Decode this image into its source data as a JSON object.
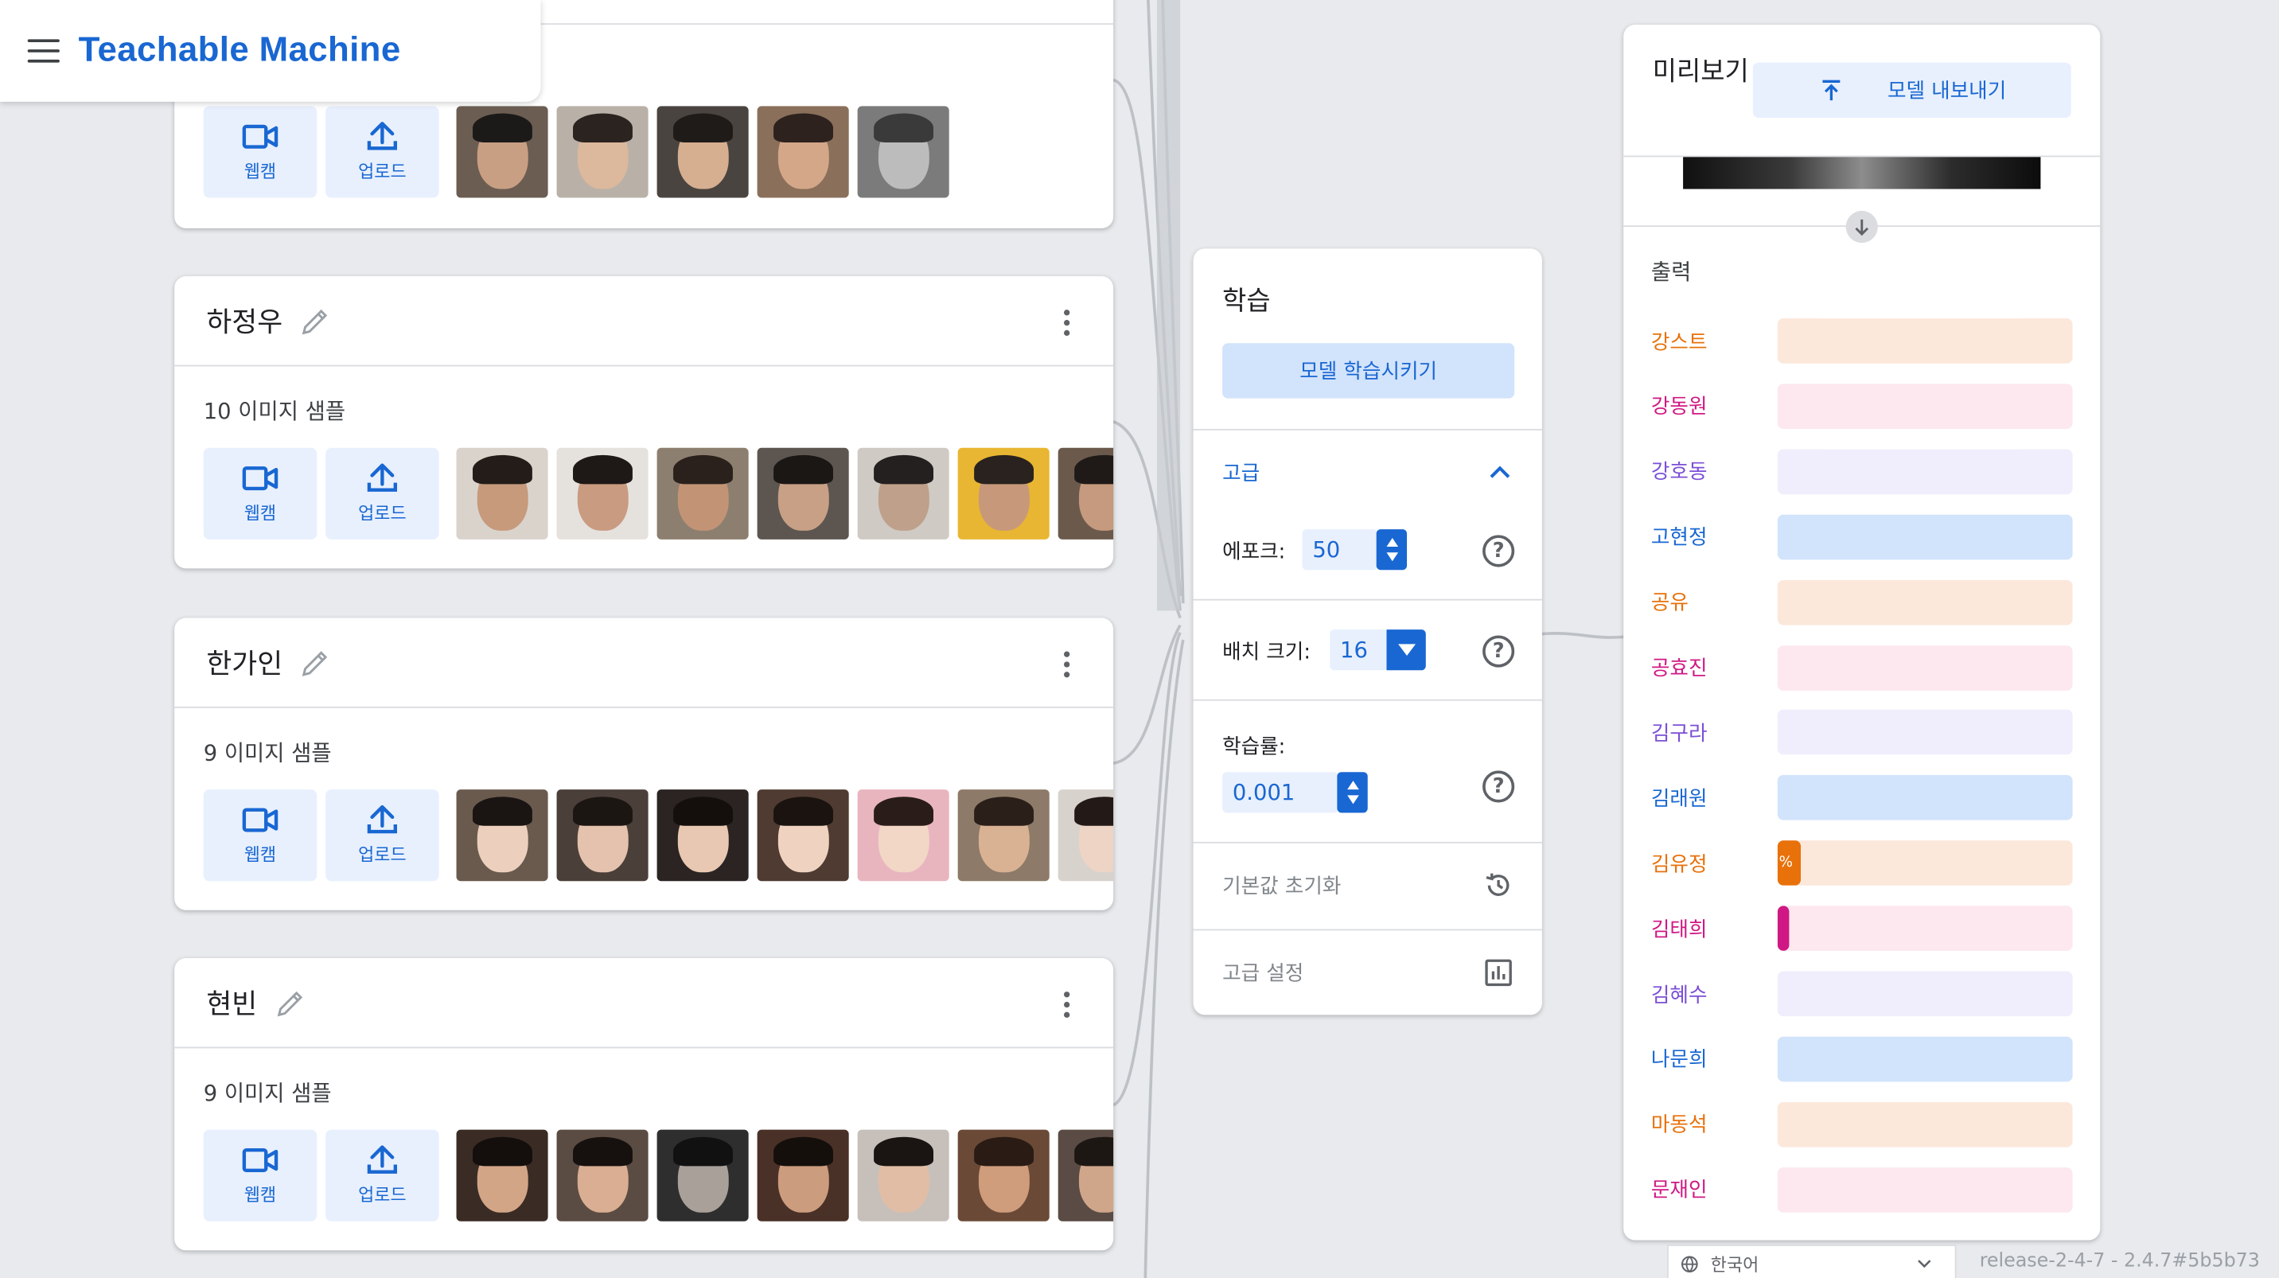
{
  "header": {
    "title": "Teachable Machine",
    "menu_icon": "menu-icon"
  },
  "classes": [
    {
      "name": "",
      "count_text": "",
      "webcam_label": "웹캠",
      "upload_label": "업로드",
      "thumb_count": 5
    },
    {
      "name": "하정우",
      "count_text": "10 이미지 샘플",
      "webcam_label": "웹캠",
      "upload_label": "업로드",
      "thumb_count": 7
    },
    {
      "name": "한가인",
      "count_text": "9 이미지 샘플",
      "webcam_label": "웹캠",
      "upload_label": "업로드",
      "thumb_count": 7
    },
    {
      "name": "현빈",
      "count_text": "9 이미지 샘플",
      "webcam_label": "웹캠",
      "upload_label": "업로드",
      "thumb_count": 7
    }
  ],
  "training": {
    "title": "학습",
    "train_button": "모델 학습시키기",
    "advanced_label": "고급",
    "epochs_label": "에포크:",
    "epochs_value": "50",
    "batch_label": "배치 크기:",
    "batch_value": "16",
    "lr_label": "학습률:",
    "lr_value": "0.001",
    "reset_label": "기본값 초기화",
    "advanced_settings_label": "고급 설정"
  },
  "preview": {
    "title": "미리보기",
    "export_button": "모델 내보내기",
    "output_label": "출력",
    "outputs": [
      {
        "name": "강스트",
        "color": "#e8710a",
        "bg": "#fce8db",
        "value": 0
      },
      {
        "name": "강동원",
        "color": "#d01884",
        "bg": "#fce8ee",
        "value": 0
      },
      {
        "name": "강호동",
        "color": "#7b4fd6",
        "bg": "#f0edfc",
        "value": 0
      },
      {
        "name": "고현정",
        "color": "#1967d2",
        "bg": "#d2e3fc",
        "value": 0
      },
      {
        "name": "공유",
        "color": "#e8710a",
        "bg": "#fce8db",
        "value": 0
      },
      {
        "name": "공효진",
        "color": "#d01884",
        "bg": "#fce8ee",
        "value": 0
      },
      {
        "name": "김구라",
        "color": "#7b4fd6",
        "bg": "#f0edfc",
        "value": 0
      },
      {
        "name": "김래원",
        "color": "#1967d2",
        "bg": "#d2e3fc",
        "value": 0
      },
      {
        "name": "김유정",
        "color": "#e8710a",
        "bg": "#fce8db",
        "value": 0.08,
        "fill_text": "%"
      },
      {
        "name": "김태희",
        "color": "#d01884",
        "bg": "#fce8ee",
        "value": 0.04,
        "fill_text": ""
      },
      {
        "name": "김혜수",
        "color": "#7b4fd6",
        "bg": "#f0edfc",
        "value": 0
      },
      {
        "name": "나문희",
        "color": "#1967d2",
        "bg": "#d2e3fc",
        "value": 0
      },
      {
        "name": "마동석",
        "color": "#e8710a",
        "bg": "#fce8db",
        "value": 0
      },
      {
        "name": "문재인",
        "color": "#d01884",
        "bg": "#fce8ee",
        "value": 0
      }
    ]
  },
  "footer": {
    "language": "한국어",
    "release": "release-2-4-7 - 2.4.7#5b5b73"
  }
}
